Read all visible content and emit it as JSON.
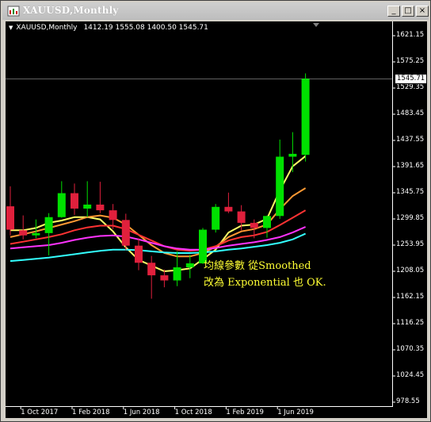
{
  "window": {
    "title": "XAUUSD,Monthly",
    "buttons": {
      "minimize": "_",
      "maximize": "□",
      "close": "×"
    }
  },
  "chart_header": {
    "symbol": "XAUUSD,Monthly",
    "ohlc": "1412.19 1555.08 1400.50 1545.71"
  },
  "current_price": "1545.71",
  "annotation": {
    "line1": "均線參數 從Smoothed",
    "line2": "改為 Exponential 也 OK."
  },
  "colors": {
    "background": "#000000",
    "bull": "#00e000",
    "bear": "#e0203c",
    "annotation": "#ffff33"
  },
  "icons": {
    "app": "chart-window-icon",
    "scroll_marker": "triangle-down-icon"
  },
  "chart_data": {
    "type": "candlestick",
    "title": "XAUUSD,Monthly",
    "y_ticks": [
      "1621.15",
      "1575.25",
      "1529.35",
      "1483.45",
      "1437.55",
      "1391.65",
      "1345.75",
      "1299.85",
      "1253.95",
      "1208.05",
      "1162.15",
      "1116.25",
      "1070.35",
      "1024.45",
      "978.55"
    ],
    "x_ticks": [
      "1 Oct 2017",
      "1 Feb 2018",
      "1 Jun 2018",
      "1 Oct 2018",
      "1 Feb 2019",
      "1 Jun 2019"
    ],
    "ylim": [
      978.55,
      1636
    ],
    "candles": [
      {
        "date": "2017-09",
        "open": 1322,
        "high": 1357,
        "low": 1271,
        "close": 1281
      },
      {
        "date": "2017-10",
        "open": 1280,
        "high": 1306,
        "low": 1264,
        "close": 1271
      },
      {
        "date": "2017-11",
        "open": 1271,
        "high": 1299,
        "low": 1266,
        "close": 1275
      },
      {
        "date": "2017-12",
        "open": 1275,
        "high": 1310,
        "low": 1236,
        "close": 1303
      },
      {
        "date": "2018-01",
        "open": 1303,
        "high": 1366,
        "low": 1302,
        "close": 1345
      },
      {
        "date": "2018-02",
        "open": 1345,
        "high": 1362,
        "low": 1307,
        "close": 1318
      },
      {
        "date": "2018-03",
        "open": 1318,
        "high": 1366,
        "low": 1303,
        "close": 1325
      },
      {
        "date": "2018-04",
        "open": 1325,
        "high": 1365,
        "low": 1310,
        "close": 1315
      },
      {
        "date": "2018-05",
        "open": 1315,
        "high": 1326,
        "low": 1282,
        "close": 1298
      },
      {
        "date": "2018-06",
        "open": 1298,
        "high": 1309,
        "low": 1245,
        "close": 1253
      },
      {
        "date": "2018-07",
        "open": 1253,
        "high": 1266,
        "low": 1210,
        "close": 1223
      },
      {
        "date": "2018-08",
        "open": 1223,
        "high": 1235,
        "low": 1160,
        "close": 1201
      },
      {
        "date": "2018-09",
        "open": 1201,
        "high": 1211,
        "low": 1180,
        "close": 1192
      },
      {
        "date": "2018-10",
        "open": 1192,
        "high": 1243,
        "low": 1182,
        "close": 1215
      },
      {
        "date": "2018-11",
        "open": 1215,
        "high": 1237,
        "low": 1196,
        "close": 1222
      },
      {
        "date": "2018-12",
        "open": 1222,
        "high": 1284,
        "low": 1221,
        "close": 1281
      },
      {
        "date": "2019-01",
        "open": 1281,
        "high": 1326,
        "low": 1276,
        "close": 1321
      },
      {
        "date": "2019-02",
        "open": 1321,
        "high": 1346,
        "low": 1310,
        "close": 1313
      },
      {
        "date": "2019-03",
        "open": 1313,
        "high": 1324,
        "low": 1280,
        "close": 1293
      },
      {
        "date": "2019-04",
        "open": 1293,
        "high": 1299,
        "low": 1266,
        "close": 1284
      },
      {
        "date": "2019-05",
        "open": 1284,
        "high": 1306,
        "low": 1267,
        "close": 1305
      },
      {
        "date": "2019-06",
        "open": 1305,
        "high": 1439,
        "low": 1300,
        "close": 1409
      },
      {
        "date": "2019-07",
        "open": 1409,
        "high": 1452,
        "low": 1382,
        "close": 1414
      },
      {
        "date": "2019-08",
        "open": 1412.19,
        "high": 1555.08,
        "low": 1400.5,
        "close": 1545.71
      }
    ],
    "moving_averages": [
      {
        "color": "#ffff66",
        "values": [
          1280,
          1280,
          1284,
          1293,
          1297,
          1303,
          1303,
          1299,
          1278,
          1250,
          1228,
          1218,
          1208,
          1210,
          1213,
          1229,
          1246,
          1276,
          1288,
          1290,
          1300,
          1350,
          1392,
          1410
        ]
      },
      {
        "color": "#ff9933",
        "values": [
          1268,
          1273,
          1278,
          1284,
          1290,
          1296,
          1303,
          1306,
          1302,
          1290,
          1272,
          1254,
          1240,
          1234,
          1234,
          1240,
          1251,
          1268,
          1278,
          1282,
          1290,
          1317,
          1340,
          1354
        ]
      },
      {
        "color": "#ff3333",
        "values": [
          1256,
          1260,
          1264,
          1268,
          1273,
          1280,
          1285,
          1288,
          1288,
          1282,
          1272,
          1262,
          1252,
          1246,
          1244,
          1246,
          1252,
          1262,
          1268,
          1271,
          1277,
          1289,
          1302,
          1315
        ]
      },
      {
        "color": "#ff33ff",
        "values": [
          1248,
          1250,
          1252,
          1254,
          1258,
          1263,
          1267,
          1270,
          1271,
          1269,
          1264,
          1258,
          1252,
          1248,
          1246,
          1246,
          1249,
          1253,
          1256,
          1259,
          1263,
          1268,
          1276,
          1286
        ]
      },
      {
        "color": "#33ffff",
        "values": [
          1226,
          1228,
          1230,
          1232,
          1235,
          1238,
          1241,
          1244,
          1246,
          1246,
          1245,
          1243,
          1241,
          1240,
          1240,
          1241,
          1243,
          1246,
          1248,
          1251,
          1254,
          1258,
          1264,
          1274
        ]
      }
    ]
  }
}
